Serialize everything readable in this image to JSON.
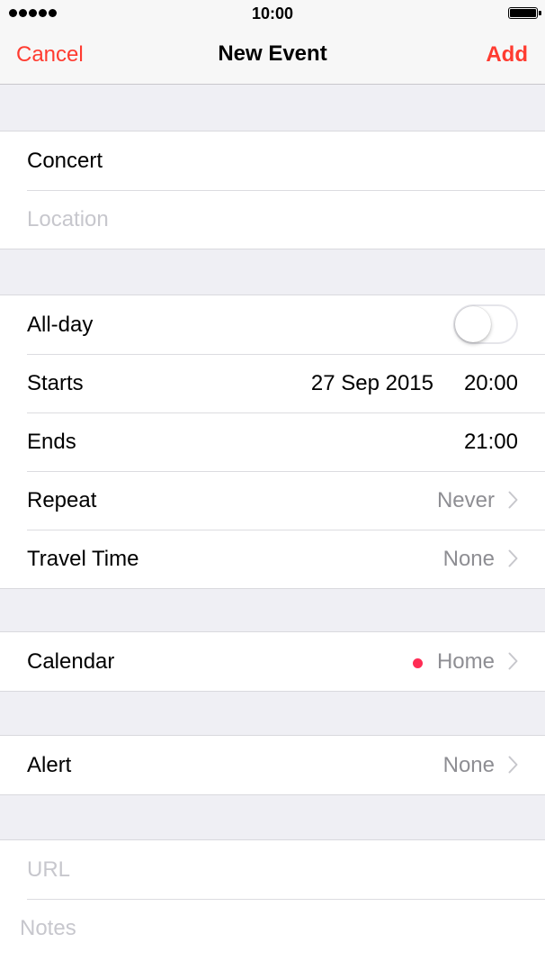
{
  "status_bar": {
    "time": "10:00"
  },
  "nav": {
    "cancel": "Cancel",
    "title": "New Event",
    "add": "Add",
    "accent_color": "#ff3b30"
  },
  "event": {
    "title_value": "Concert",
    "location_placeholder": "Location"
  },
  "schedule": {
    "all_day_label": "All-day",
    "all_day_on": false,
    "starts_label": "Starts",
    "starts_date": "27 Sep 2015",
    "starts_time": "20:00",
    "ends_label": "Ends",
    "ends_time": "21:00",
    "repeat_label": "Repeat",
    "repeat_value": "Never",
    "travel_label": "Travel Time",
    "travel_value": "None"
  },
  "calendar": {
    "label": "Calendar",
    "value": "Home",
    "dot_color": "#ff2d55"
  },
  "alert": {
    "label": "Alert",
    "value": "None"
  },
  "extra": {
    "url_placeholder": "URL",
    "notes_placeholder": "Notes"
  },
  "icons": {
    "chevron": "chevron-right-icon"
  }
}
